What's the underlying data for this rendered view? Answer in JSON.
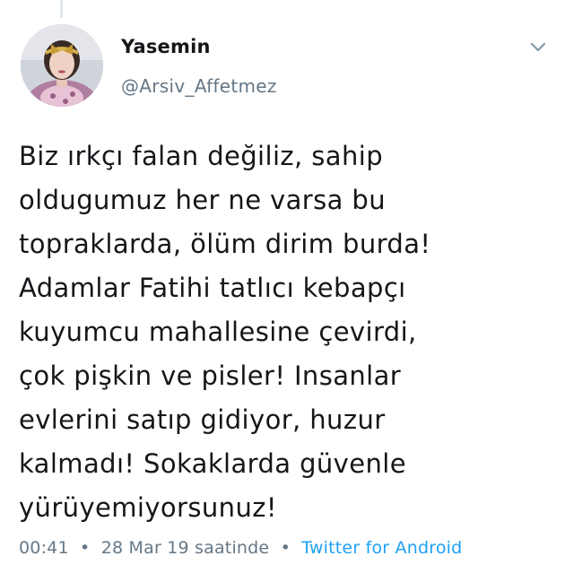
{
  "tweet": {
    "author_name": "Yasemin",
    "author_handle": "@Arsiv_Affetmez",
    "text_lines": [
      "Biz ırkçı falan değiliz, sahip",
      "oldugumuz her ne varsa bu",
      "topraklarda, ölüm dirim burda!",
      "Adamlar Fatihi tatlıcı kebapçı",
      "kuyumcu mahallesine çevirdi,",
      "çok pişkin ve pisler! Insanlar",
      "evlerini satıp gidiyor, huzur",
      "kalmadı! Sokaklarda güvenle",
      "yürüyemiyorsunuz!"
    ],
    "time": "00:41",
    "date": "28 Mar 19 saatinde",
    "separator": "•",
    "source": "Twitter for Android"
  },
  "icons": {
    "caret": "chevron-down-icon",
    "avatar": "profile-photo"
  },
  "colors": {
    "text": "#14171a",
    "secondary": "#657786",
    "link": "#1da1f2",
    "background": "#ffffff"
  }
}
